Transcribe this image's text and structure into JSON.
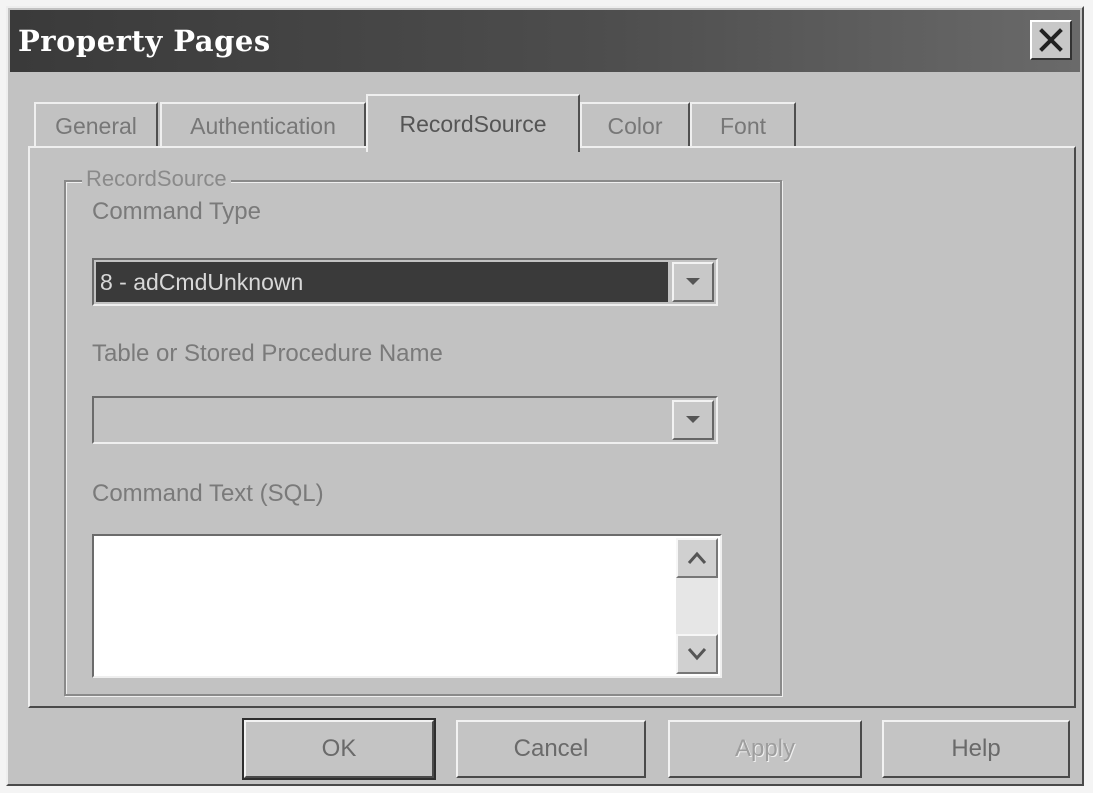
{
  "window": {
    "title": "Property Pages"
  },
  "tabs": [
    {
      "label": "General",
      "active": false
    },
    {
      "label": "Authentication",
      "active": false
    },
    {
      "label": "RecordSource",
      "active": true
    },
    {
      "label": "Color",
      "active": false
    },
    {
      "label": "Font",
      "active": false
    }
  ],
  "recordsource": {
    "group_label": "RecordSource",
    "command_type_label": "Command Type",
    "command_type_value": "8 - adCmdUnknown",
    "table_label": "Table or Stored Procedure Name",
    "table_value": "",
    "command_text_label": "Command Text (SQL)",
    "command_text_value": ""
  },
  "buttons": {
    "ok": "OK",
    "cancel": "Cancel",
    "apply": "Apply",
    "help": "Help"
  },
  "icons": {
    "close": "close-icon",
    "dropdown": "chevron-down-icon",
    "scroll_up": "scroll-up-icon",
    "scroll_down": "scroll-down-icon"
  }
}
